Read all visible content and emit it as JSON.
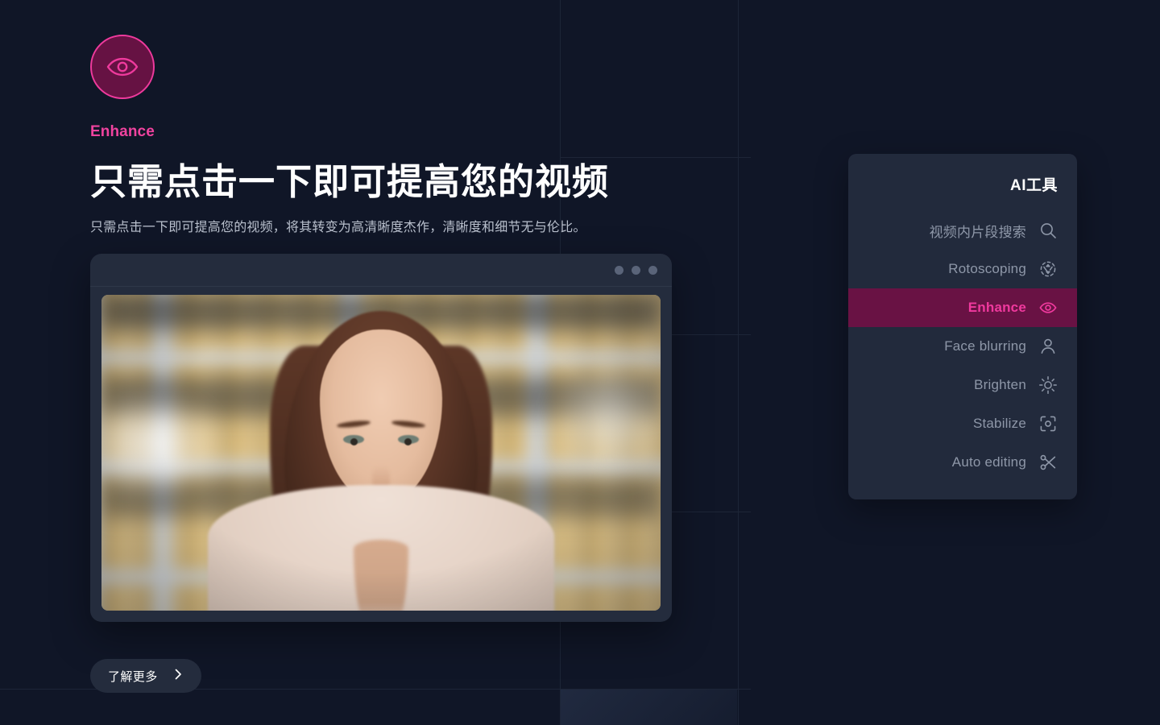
{
  "brand": {
    "logo_icon": "eye-icon",
    "logo_fill": "#661243",
    "logo_stroke": "#ef3a9d",
    "eyebrow": "Enhance",
    "accent": "#f0399e"
  },
  "hero": {
    "headline": "只需点击一下即可提高您的视频",
    "subhead": "只需点击一下即可提高您的视频，将其转变为高清晰度杰作，清晰度和细节无与伦比。",
    "cta_label": "了解更多",
    "cta_icon": "chevron-right-icon"
  },
  "preview": {
    "window_dots": 3,
    "media_alt": "smiling woman in front of blurred library bookshelves"
  },
  "tools_panel": {
    "title": "AI工具",
    "items": [
      {
        "label": "视频内片段搜索",
        "icon": "search-icon",
        "active": false
      },
      {
        "label": "Rotoscoping",
        "icon": "rotoscope-icon",
        "active": false
      },
      {
        "label": "Enhance",
        "icon": "eye-icon",
        "active": true
      },
      {
        "label": "Face blurring",
        "icon": "person-icon",
        "active": false
      },
      {
        "label": "Brighten",
        "icon": "sun-icon",
        "active": false
      },
      {
        "label": "Stabilize",
        "icon": "focus-frame-icon",
        "active": false
      },
      {
        "label": "Auto editing",
        "icon": "scissors-icon",
        "active": false
      }
    ],
    "background": "#222a3c",
    "active_background": "#691244"
  },
  "theme": {
    "page_background": "#101627",
    "grid_line": "#1d2537",
    "panel": "#242c3d"
  }
}
